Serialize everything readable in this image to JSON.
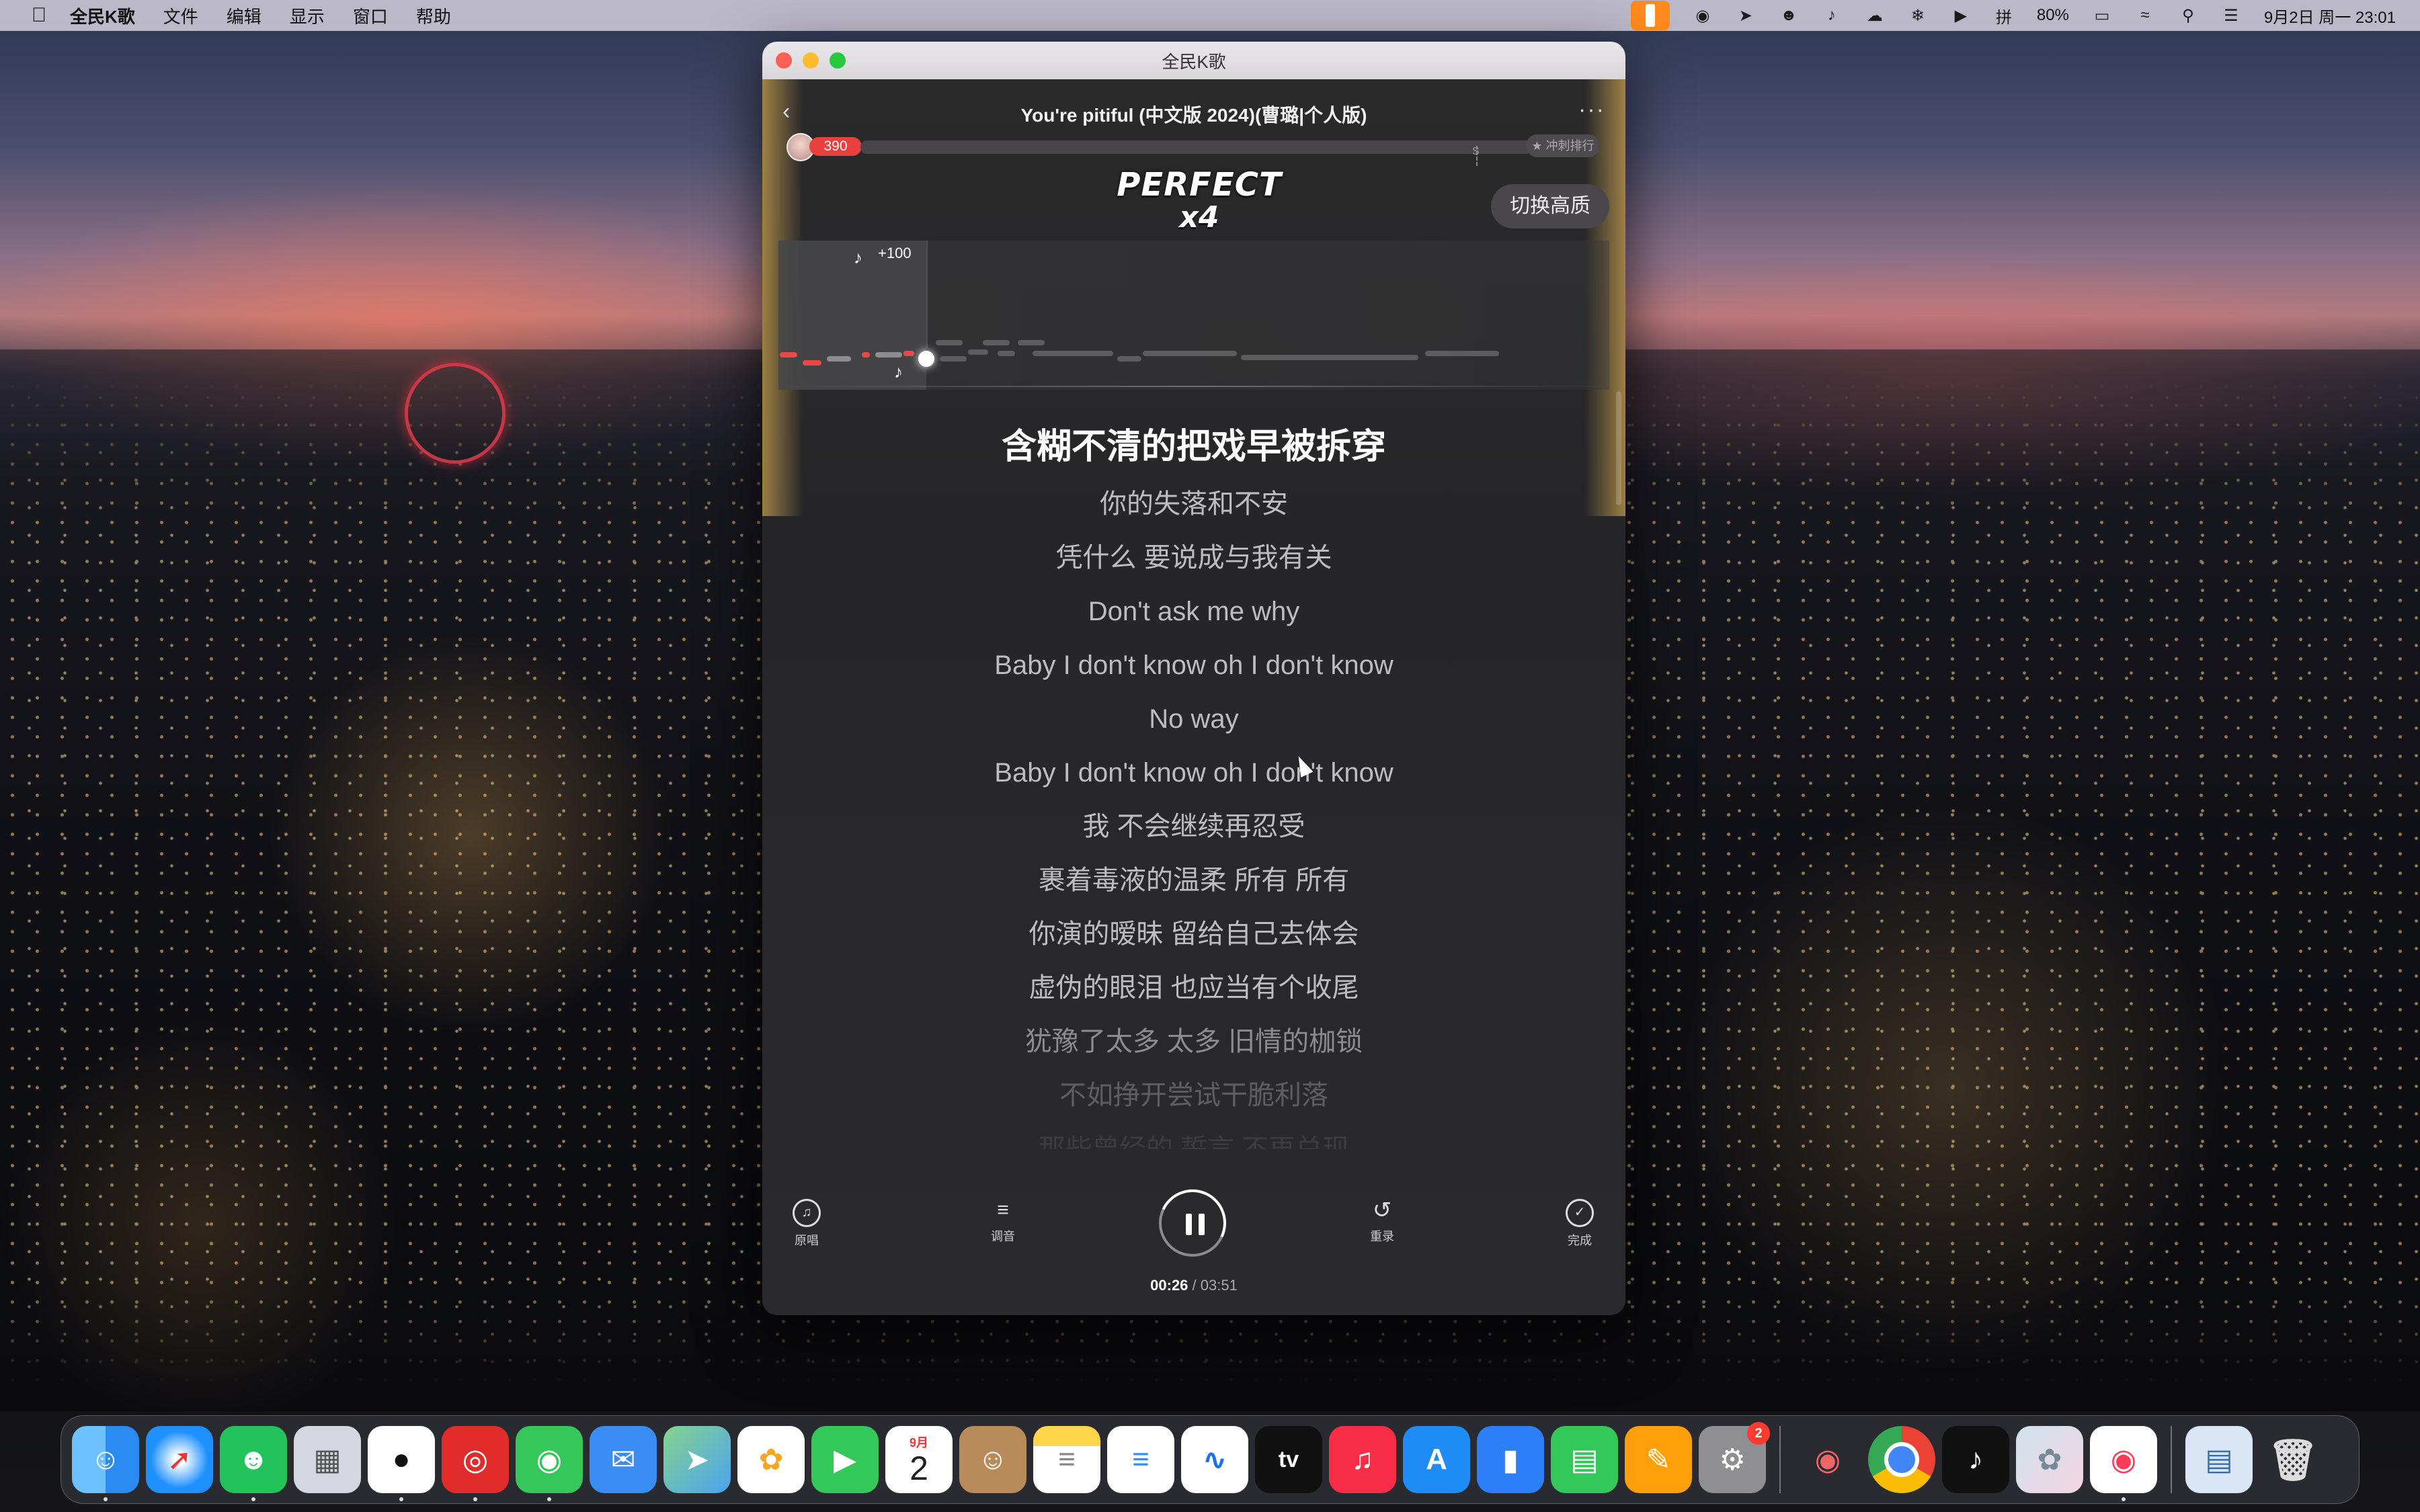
{
  "menubar": {
    "app_name": "全民K歌",
    "items": [
      "文件",
      "编辑",
      "显示",
      "窗口",
      "帮助"
    ],
    "battery": "80%",
    "datetime": "9月2日 周一  23:01"
  },
  "window": {
    "title": "全民K歌",
    "song_title": "You're pitiful (中文版 2024)(曹璐|个人版)",
    "score": "390",
    "progress_fraction": 0.0,
    "progress_marker": "S",
    "rank_label": "冲刺排行",
    "perfect_text": "PERFECT",
    "combo_text": "x4",
    "quality_button": "切换高质",
    "pitch_bonus": "+100",
    "lyrics": [
      "含糊不清的把戏早被拆穿",
      "你的失落和不安",
      "凭什么 要说成与我有关",
      "Don't ask me why",
      "Baby I don't know oh I don't know",
      "No way",
      "Baby I don't know oh I don't know",
      "我 不会继续再忍受",
      "裹着毒液的温柔 所有 所有",
      "你演的暧昧 留给自己去体会",
      "虚伪的眼泪 也应当有个收尾",
      "犹豫了太多 太多 旧情的枷锁",
      "不如挣开尝试干脆利落",
      "那些曾经的 誓言 不再兑现"
    ],
    "controls": {
      "original": "原唱",
      "tune": "调音",
      "restart": "重录",
      "finish": "完成"
    },
    "time_current": "00:26",
    "time_total": "03:51"
  },
  "dock": {
    "apps": [
      {
        "name": "finder-icon",
        "color": "#2a8cf0"
      },
      {
        "name": "safari-icon",
        "color": "#1e90ff"
      },
      {
        "name": "wechat-icon",
        "color": "#21c35a"
      },
      {
        "name": "launchpad-icon",
        "color": "#e0e0e8"
      },
      {
        "name": "qq-icon",
        "color": "#ffffff"
      },
      {
        "name": "netease-music-icon",
        "color": "#e22c2c"
      },
      {
        "name": "messages-icon",
        "color": "#35c759"
      },
      {
        "name": "mail-icon",
        "color": "#3a8df5"
      },
      {
        "name": "maps-icon",
        "color": "#5fbf6c"
      },
      {
        "name": "photos-icon",
        "color": "#ffffff"
      },
      {
        "name": "facetime-icon",
        "color": "#34c759"
      },
      {
        "name": "calendar-icon",
        "color": "#ffffff"
      },
      {
        "name": "contacts-icon",
        "color": "#b98b5a"
      },
      {
        "name": "notes-icon",
        "color": "#ffd54a"
      },
      {
        "name": "reminders-icon",
        "color": "#ffffff"
      },
      {
        "name": "freeform-icon",
        "color": "#ffffff"
      },
      {
        "name": "apple-tv-icon",
        "color": "#111111"
      },
      {
        "name": "music-icon",
        "color": "#fa2d48"
      },
      {
        "name": "app-store-icon",
        "color": "#1f8cf5"
      },
      {
        "name": "keynote-icon",
        "color": "#2d7ff9"
      },
      {
        "name": "numbers-icon",
        "color": "#34c759"
      },
      {
        "name": "pages-icon",
        "color": "#ff9f0a"
      },
      {
        "name": "system-settings-icon",
        "color": "#8e8e93"
      },
      {
        "name": "karaoke-icon",
        "color": "#f6e6d0"
      },
      {
        "name": "chrome-icon",
        "color": "#ffffff"
      },
      {
        "name": "tiktok-icon",
        "color": "#111111"
      },
      {
        "name": "photo-thumbnail-icon",
        "color": "#cfe3ee"
      },
      {
        "name": "quanmin-kge-icon",
        "color": "#ff3b57"
      },
      {
        "name": "downloads-stack-icon",
        "color": "#d9e6f5"
      },
      {
        "name": "trash-icon",
        "color": "#dcdcdc"
      }
    ],
    "calendar_month": "9月",
    "calendar_day": "2",
    "settings_badge": "2"
  }
}
